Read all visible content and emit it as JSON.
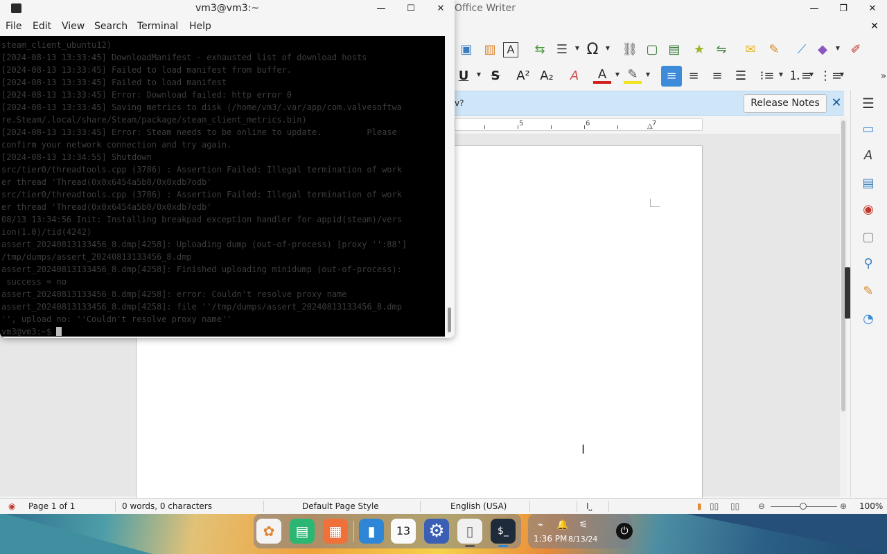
{
  "writer": {
    "title": "Office Writer",
    "infobar": {
      "text": "v?",
      "release_notes_label": "Release Notes"
    },
    "ruler_numbers": [
      "5",
      "6",
      "7"
    ],
    "status": {
      "page": "Page 1 of 1",
      "words": "0 words, 0 characters",
      "page_style": "Default Page Style",
      "language": "English (USA)",
      "zoom": "100%"
    }
  },
  "terminal": {
    "title": "vm3@vm3:~",
    "menu": [
      "File",
      "Edit",
      "View",
      "Search",
      "Terminal",
      "Help"
    ],
    "lines": [
      "steam_client_ubuntu12)",
      "[2024-08-13 13:33:45] DownloadManifest - exhausted list of download hosts",
      "[2024-08-13 13:33:45] Failed to load manifest from buffer.",
      "[2024-08-13 13:33:45] Failed to load manifest",
      "[2024-08-13 13:33:45] Error: Download failed: http error 0",
      "[2024-08-13 13:33:45] Saving metrics to disk (/home/vm3/.var/app/com.valvesoftwa",
      "re.Steam/.local/share/Steam/package/steam_client_metrics.bin)",
      "[2024-08-13 13:33:45] Error: Steam needs to be online to update.         Please",
      "confirm your network connection and try again.",
      "[2024-08-13 13:34:55] Shutdown",
      "src/tier0/threadtools.cpp (3786) : Assertion Failed: Illegal termination of work",
      "er thread 'Thread(0x0x6454a5b0/0x0xdb7odb'",
      "src/tier0/threadtools.cpp (3786) : Assertion Failed: Illegal termination of work",
      "er thread 'Thread(0x0x6454a5b0/0x0xdb7odb'",
      "08/13 13:34:56 Init: Installing breakpad exception handler for appid(steam)/vers",
      "ion(1.0)/tid(4242)",
      "assert_20240813133456_8.dmp[4258]: Uploading dump (out-of-process) [proxy '':88']",
      "/tmp/dumps/assert_20240813133456_8.dmp",
      "assert_20240813133456_8.dmp[4258]: Finished uploading minidump (out-of-process):",
      " success = no",
      "assert_20240813133456_8.dmp[4258]: error: Couldn't resolve proxy name",
      "assert_20240813133456_8.dmp[4258]: file ''/tmp/dumps/assert_20240813133456_8.dmp",
      "'', upload no: ''Couldn't resolve proxy name''"
    ],
    "prompt": "vm3@vm3:~$ "
  },
  "taskbar": {
    "calendar_day": "13",
    "time": "1:36 PM",
    "date": "8/13/24"
  },
  "icons": {
    "accent": "#3d8bd9",
    "infobar_bg": "#cfe6f8"
  }
}
